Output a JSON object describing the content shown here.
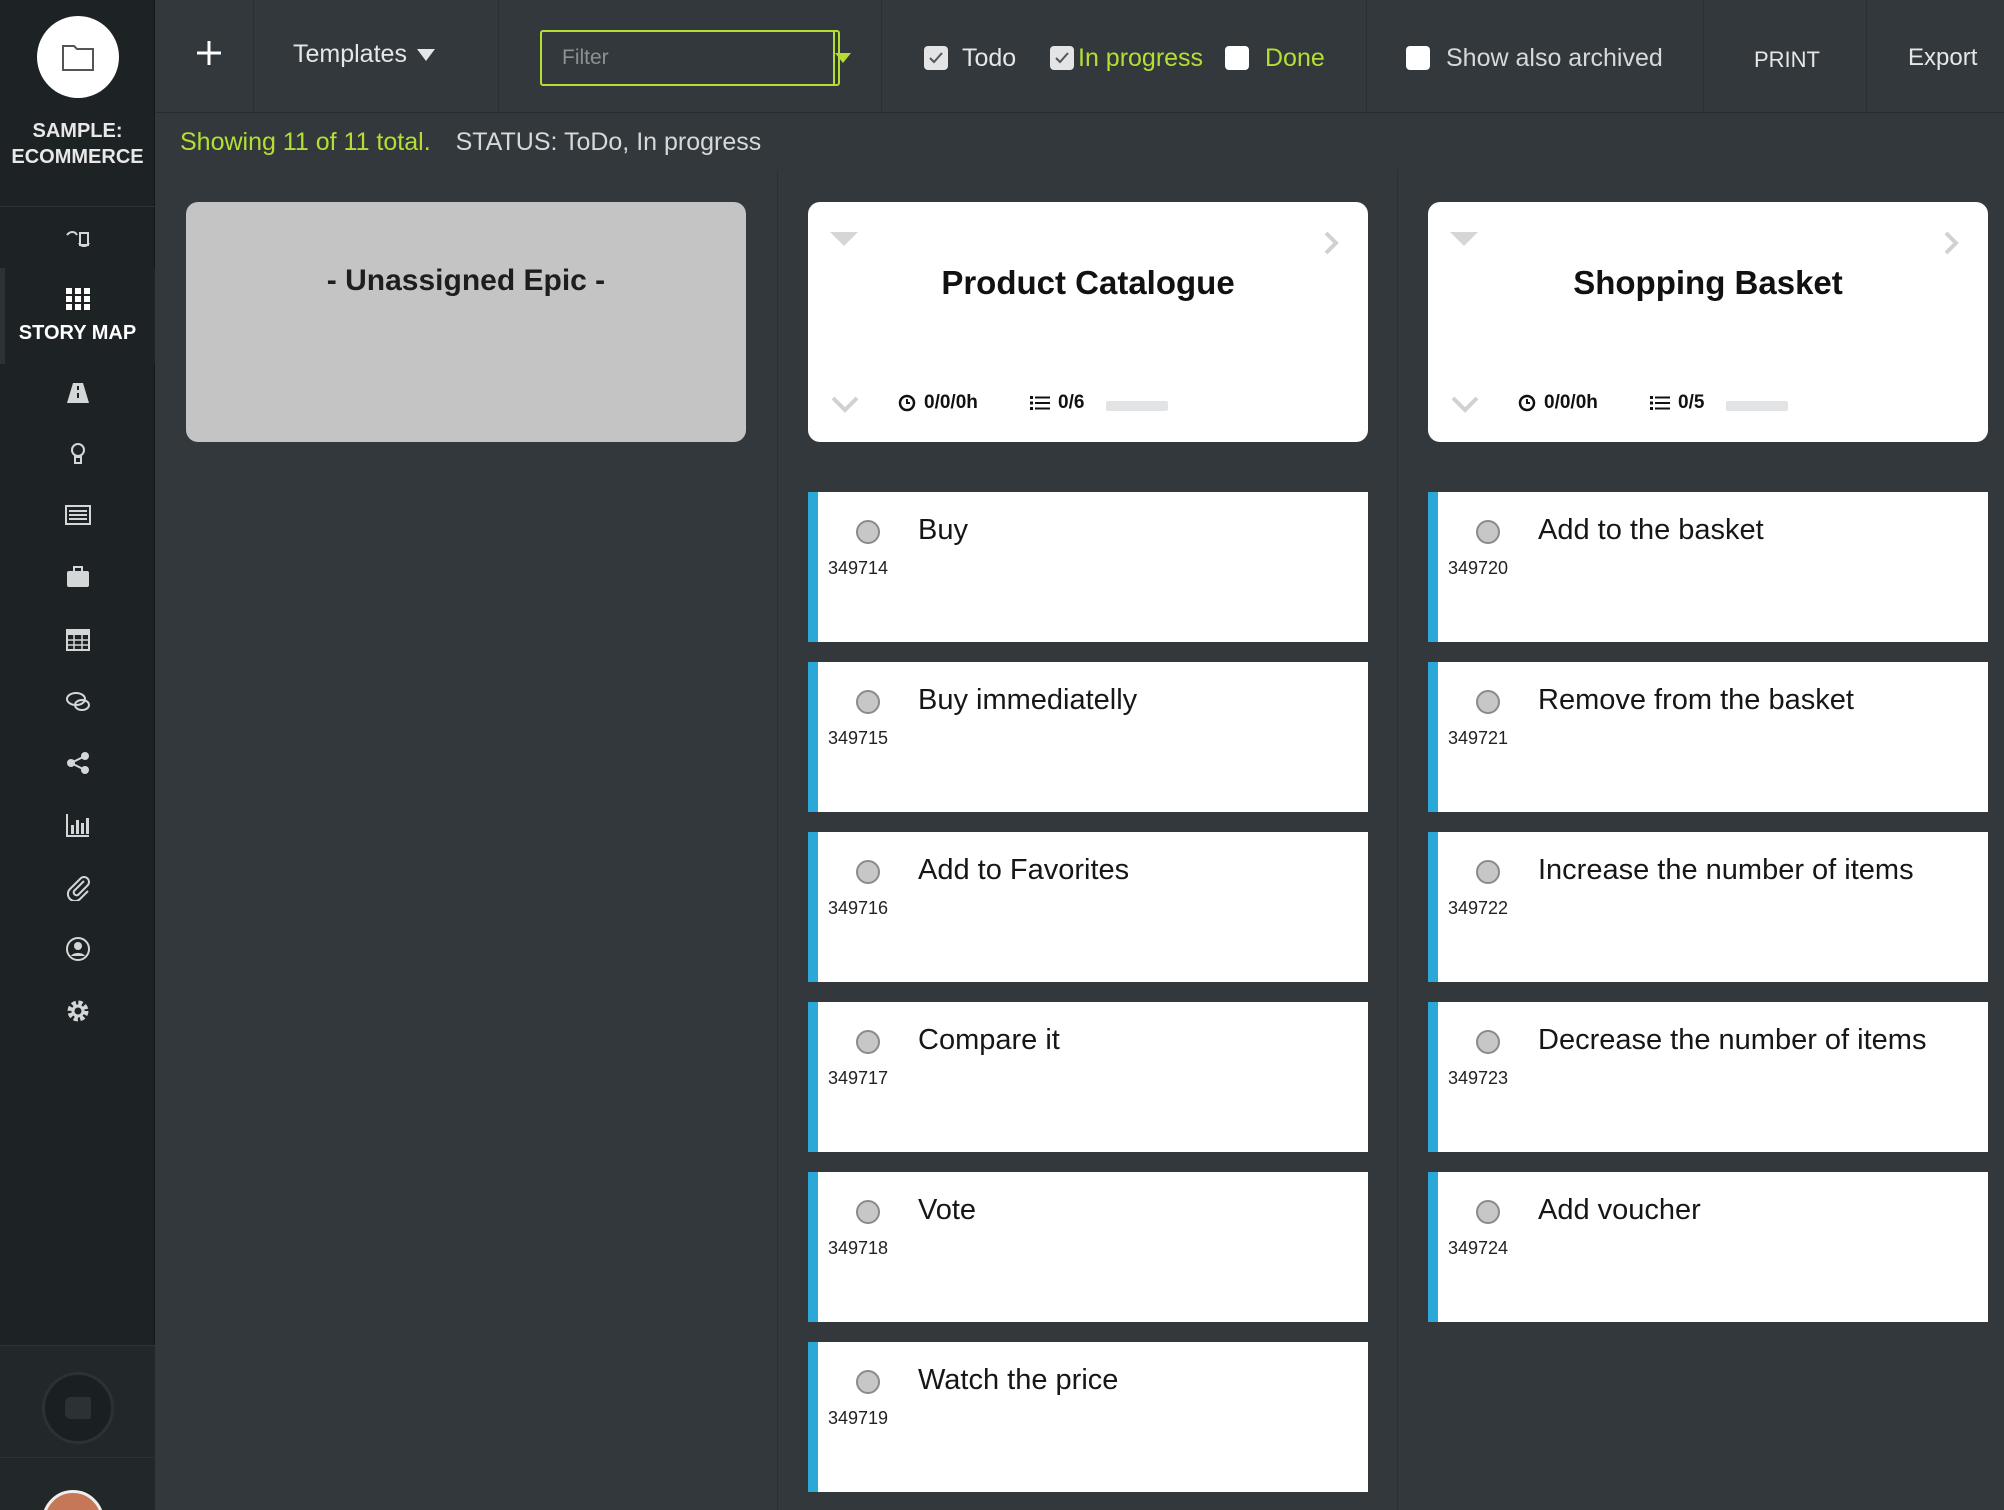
{
  "project": {
    "name_line1": "SAMPLE:",
    "name_line2": "ECOMMERCE"
  },
  "sidebar": {
    "active_label": "STORY MAP",
    "items": [
      {
        "icon": "switch-icon"
      },
      {
        "icon": "grid-icon",
        "label": "STORY MAP"
      },
      {
        "icon": "road-icon"
      },
      {
        "icon": "lightbulb-icon"
      },
      {
        "icon": "backlog-list-icon"
      },
      {
        "icon": "briefcase-icon"
      },
      {
        "icon": "calendar-icon"
      },
      {
        "icon": "chat-icon"
      },
      {
        "icon": "share-icon"
      },
      {
        "icon": "bar-chart-icon"
      },
      {
        "icon": "paperclip-icon"
      },
      {
        "icon": "user-circle-icon"
      },
      {
        "icon": "settings-gear-icon"
      }
    ]
  },
  "toolbar": {
    "templates_label": "Templates",
    "filter_placeholder": "Filter",
    "filters": [
      {
        "label": "Todo",
        "checked": true,
        "color": "#e4e6e7"
      },
      {
        "label": "In progress",
        "checked": true,
        "color": "#b4df32"
      },
      {
        "label": "Done",
        "checked": false,
        "color": "#b4df32"
      }
    ],
    "archived_label": "Show also archived",
    "archived_checked": false,
    "print_label": "PRINT",
    "export_label": "Export"
  },
  "status": {
    "count_text": "Showing 11 of 11 total.",
    "status_text": "STATUS: ToDo, In progress"
  },
  "epics": {
    "unassigned_title": "- Unassigned Epic -",
    "list": [
      {
        "title": "Product Catalogue",
        "time": "0/0/0h",
        "tasks": "0/6",
        "progress": 0
      },
      {
        "title": "Shopping Basket",
        "time": "0/0/0h",
        "tasks": "0/5",
        "progress": 0
      }
    ]
  },
  "stories": {
    "product_catalogue": [
      {
        "title": "Buy",
        "id": "349714"
      },
      {
        "title": "Buy immediatelly",
        "id": "349715"
      },
      {
        "title": "Add to Favorites",
        "id": "349716"
      },
      {
        "title": "Compare it",
        "id": "349717"
      },
      {
        "title": "Vote",
        "id": "349718"
      },
      {
        "title": "Watch the price",
        "id": "349719"
      }
    ],
    "shopping_basket": [
      {
        "title": "Add to the basket",
        "id": "349720"
      },
      {
        "title": "Remove from the basket",
        "id": "349721"
      },
      {
        "title": "Increase the number of items",
        "id": "349722"
      },
      {
        "title": "Decrease the number of items",
        "id": "349723"
      },
      {
        "title": "Add voucher",
        "id": "349724"
      }
    ]
  },
  "colors": {
    "accent_green": "#b4df32",
    "story_border": "#2ca8d8",
    "background": "#32383b",
    "sidebar": "#1d2224"
  }
}
